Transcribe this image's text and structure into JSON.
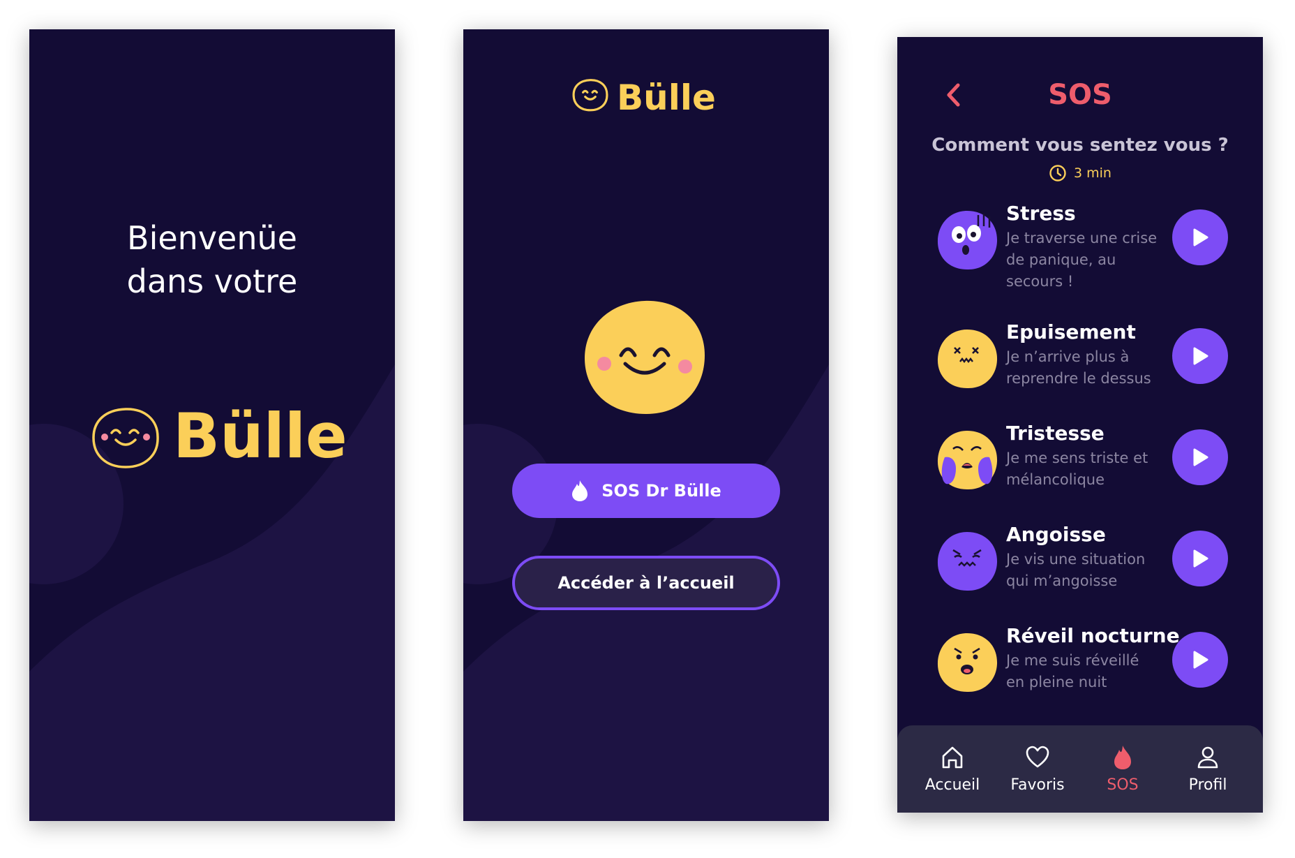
{
  "colors": {
    "background": "#130c35",
    "accent_purple": "#7d4cf5",
    "yellow": "#fbcf59",
    "sos_red": "#ee5d6c"
  },
  "splash": {
    "welcome_text": "Bienvenüe dans votre",
    "brand": "Bülle"
  },
  "home": {
    "brand": "Bülle",
    "sos_button": "SOS Dr Bülle",
    "home_button": "Accéder à l’accueil"
  },
  "sos": {
    "title": "SOS",
    "question": "Comment vous sentez vous ?",
    "duration": "3 min",
    "items": [
      {
        "name": "Stress",
        "description": "Je traverse une crise de panique, au secours !",
        "emoji": "stressed-face-icon"
      },
      {
        "name": "Epuisement",
        "description": "Je n’arrive plus à reprendre  le dessus",
        "emoji": "exhausted-face-icon"
      },
      {
        "name": "Tristesse",
        "description": "Je me sens triste et mélancolique",
        "emoji": "crying-face-icon"
      },
      {
        "name": "Angoisse",
        "description": "Je vis une situation qui m’angoisse",
        "emoji": "anxious-face-icon"
      },
      {
        "name": "Réveil nocturne",
        "description": "Je me suis réveillé en pleine nuit",
        "emoji": "surprised-face-icon"
      }
    ],
    "tabs": [
      {
        "label": "Accueil",
        "icon": "home-icon"
      },
      {
        "label": "Favoris",
        "icon": "heart-icon"
      },
      {
        "label": "SOS",
        "icon": "flame-icon",
        "active": true
      },
      {
        "label": "Profil",
        "icon": "user-icon"
      }
    ]
  }
}
